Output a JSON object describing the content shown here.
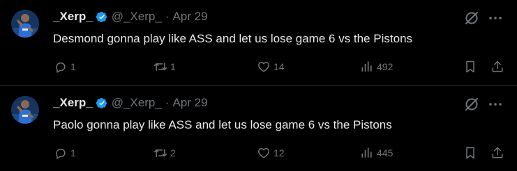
{
  "colors": {
    "background": "#000000",
    "text_primary": "#e7e9ea",
    "text_secondary": "#71767b",
    "verified_badge": "#1d9bf0",
    "divider": "#2f3336"
  },
  "icons": {
    "verified": "verified-badge-icon",
    "grok": "grok-icon",
    "more": "more-options-icon",
    "reply": "reply-icon",
    "repost": "repost-icon",
    "like": "like-icon",
    "views": "views-icon",
    "bookmark": "bookmark-icon",
    "share": "share-icon"
  },
  "tweets": [
    {
      "name": "_Xerp_",
      "handle": "@_Xerp_",
      "separator": "·",
      "date": "Apr 29",
      "text": "Desmond gonna play like ASS and let us lose game 6 vs the Pistons",
      "replies": "1",
      "reposts": "1",
      "likes": "14",
      "views": "492"
    },
    {
      "name": "_Xerp_",
      "handle": "@_Xerp_",
      "separator": "·",
      "date": "Apr 29",
      "text": "Paolo gonna play like ASS and let us lose game 6 vs the Pistons",
      "replies": "1",
      "reposts": "2",
      "likes": "12",
      "views": "445"
    }
  ]
}
